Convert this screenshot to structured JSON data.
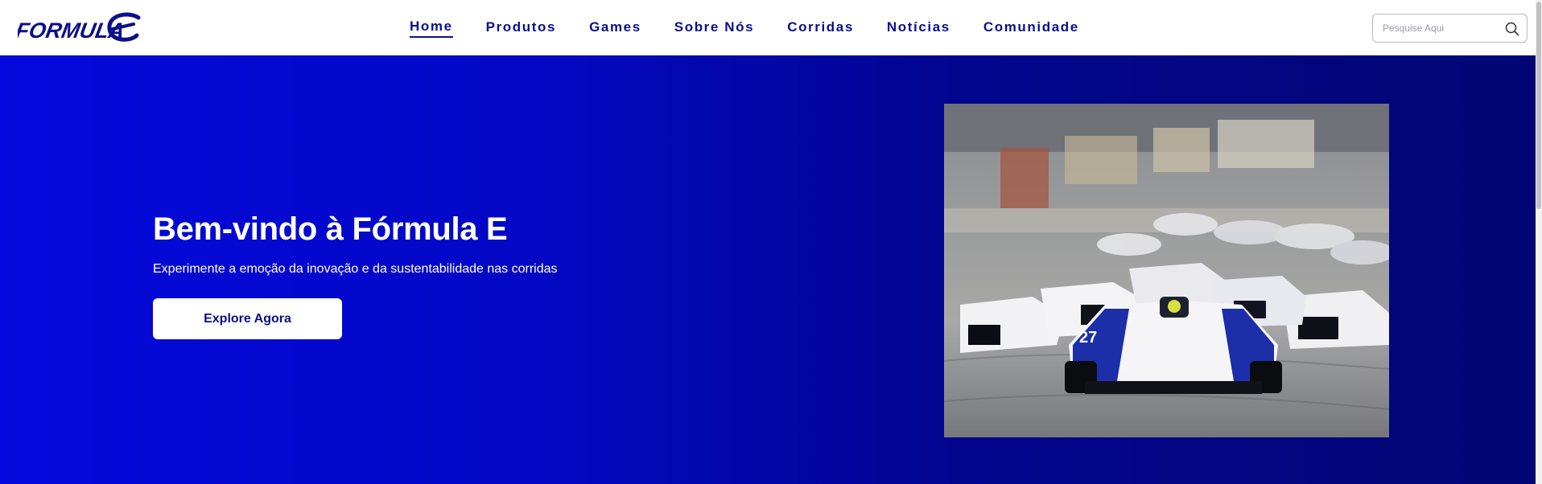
{
  "header": {
    "logo_text": "FORMULA E",
    "nav": [
      {
        "label": "Home",
        "active": true
      },
      {
        "label": "Produtos",
        "active": false
      },
      {
        "label": "Games",
        "active": false
      },
      {
        "label": "Sobre Nós",
        "active": false
      },
      {
        "label": "Corridas",
        "active": false
      },
      {
        "label": "Notícias",
        "active": false
      },
      {
        "label": "Comunidade",
        "active": false
      }
    ],
    "search": {
      "placeholder": "Pesquise Aqui",
      "value": "",
      "icon": "search-icon"
    }
  },
  "hero": {
    "title": "Bem-vindo à Fórmula E",
    "subtitle": "Experimente a emoção da inovação e da sustentabilidade nas corridas",
    "cta_label": "Explore Agora",
    "image_car_number": "27"
  },
  "colors": {
    "brand_navy": "#0b0f8a",
    "hero_gradient_start": "#0509dd",
    "hero_gradient_end": "#010674",
    "white": "#ffffff"
  }
}
